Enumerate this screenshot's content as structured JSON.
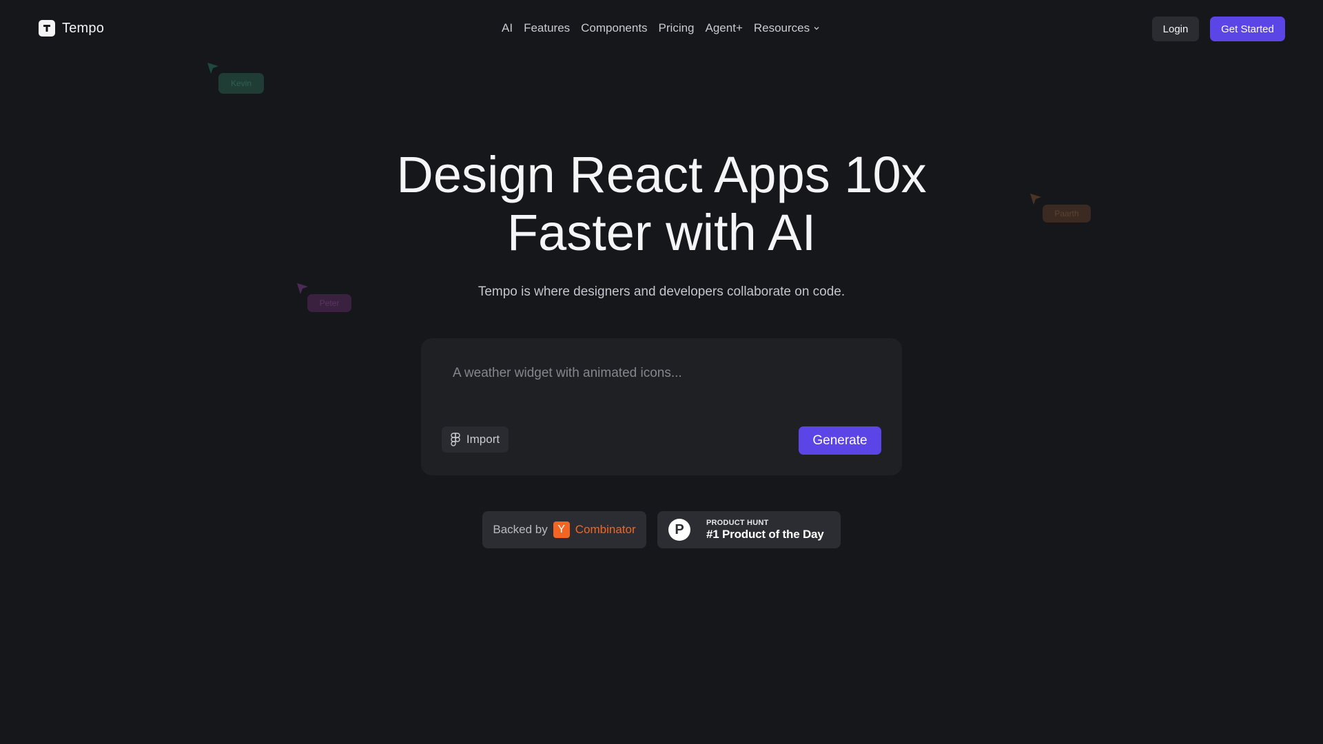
{
  "brand": {
    "name": "Tempo",
    "logo_letter": "T"
  },
  "nav": {
    "items": [
      {
        "label": "AI"
      },
      {
        "label": "Features"
      },
      {
        "label": "Components"
      },
      {
        "label": "Pricing"
      },
      {
        "label": "Agent+"
      },
      {
        "label": "Resources"
      }
    ]
  },
  "header": {
    "login_label": "Login",
    "cta_label": "Get Started"
  },
  "cursors": [
    {
      "name": "Kevin",
      "color": "#1f3d34"
    },
    {
      "name": "Paarth",
      "color": "#3a2a22"
    },
    {
      "name": "Peter",
      "color": "#3a2140"
    }
  ],
  "hero": {
    "title_line1": "Design React Apps 10x",
    "title_line2": "Faster with AI",
    "subtitle": "Tempo is where designers and developers collaborate on code."
  },
  "prompt": {
    "placeholder": "A weather widget with animated icons...",
    "import_label": "Import",
    "generate_label": "Generate"
  },
  "badges": {
    "yc": {
      "backed_by": "Backed by",
      "logo_letter": "Y",
      "name": "Combinator"
    },
    "product_hunt": {
      "logo_letter": "P",
      "small": "PRODUCT HUNT",
      "big": "#1 Product of the Day"
    }
  },
  "colors": {
    "background": "#16171b",
    "accent": "#5b45e6",
    "yc_orange": "#f26522"
  }
}
